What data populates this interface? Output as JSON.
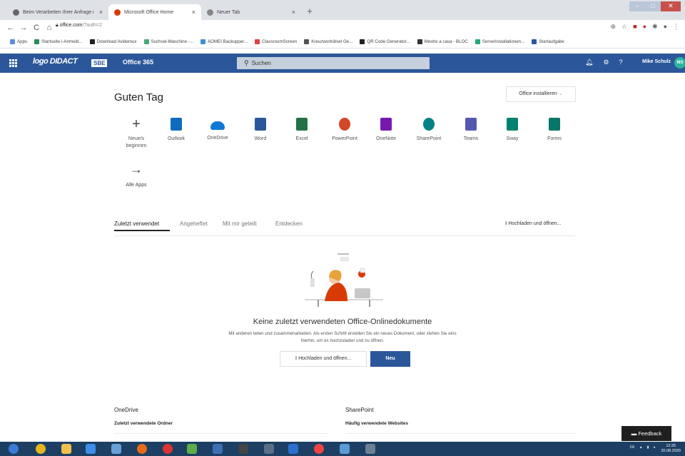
{
  "browser": {
    "tabs": [
      {
        "title": "Beim Verarbeiten Ihrer Anfrage i",
        "color": "#666666",
        "active": false
      },
      {
        "title": "Microsoft Office Home",
        "color": "#d83b01",
        "active": true
      },
      {
        "title": "Neuer Tab",
        "color": "#888888",
        "active": false
      }
    ],
    "url_host": "office.com",
    "url_path": "/?auth=2",
    "bookmarks": [
      "Apps",
      "Startseite i-Anmeld...",
      "Download Avidemux",
      "Suchsel-Maschine -...",
      "AOMEI Backupper...",
      "ClassroomScreen",
      "Kreuzworträtsel Ge...",
      "QR Code Generator...",
      "Mestre a casa - BLOC",
      "Serverinstallationen...",
      "Startaufgabe"
    ]
  },
  "header": {
    "logo_text": "logo DIDACT",
    "badge": "SBE",
    "app_title": "Office 365",
    "search_placeholder": "Suchen",
    "user_name": "Mike Schulz",
    "avatar_initials": "MS"
  },
  "main": {
    "greeting": "Guten Tag",
    "install_button": "Office installieren",
    "new_label": "Neue/s beginnen",
    "apps": [
      {
        "name": "Outlook",
        "color": "#0f6cbd"
      },
      {
        "name": "OneDrive",
        "color": "#0f78d4"
      },
      {
        "name": "Word",
        "color": "#2b579a"
      },
      {
        "name": "Excel",
        "color": "#217346"
      },
      {
        "name": "PowerPoint",
        "color": "#d24726"
      },
      {
        "name": "OneNote",
        "color": "#7719aa"
      },
      {
        "name": "SharePoint",
        "color": "#038387"
      },
      {
        "name": "Teams",
        "color": "#5558af"
      },
      {
        "name": "Sway",
        "color": "#008272"
      },
      {
        "name": "Forms",
        "color": "#077568"
      }
    ],
    "all_apps": "Alle Apps",
    "file_tabs": [
      "Zuletzt verwendet",
      "Angeheftet",
      "Mit mir geteilt",
      "Entdecken"
    ],
    "upload_open": "Hochladen und öffnen...",
    "empty_title": "Keine zuletzt verwendeten Office-Onlinedokumente",
    "empty_desc": "Mit anderen teilen und zusammenarbeiten. Als ersten Schritt erstellen Sie ein neues Dokument, oder ziehen Sie eins hierhin, um es hochzuladen und zu öffnen.",
    "upload_button": "Hochladen und öffnen...",
    "new_button": "Neu"
  },
  "sections": {
    "onedrive_title": "OneDrive",
    "onedrive_sub": "Zuletzt verwendete Ordner",
    "sharepoint_title": "SharePoint",
    "sharepoint_sub": "Häufig verwendete Websites"
  },
  "feedback": "Feedback",
  "taskbar": {
    "language": "DE",
    "time": "12:25",
    "date": "20.08.2020"
  }
}
